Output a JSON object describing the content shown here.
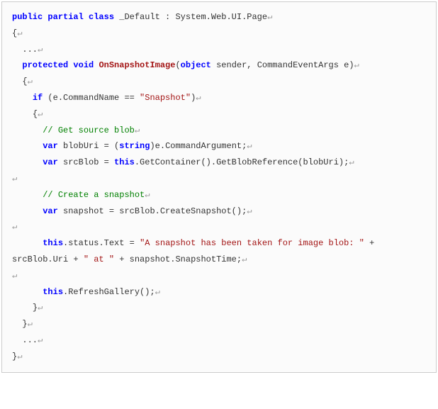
{
  "code": {
    "tokens": [
      [
        {
          "t": "public ",
          "c": "kw"
        },
        {
          "t": "partial ",
          "c": "kw"
        },
        {
          "t": "class ",
          "c": "kw"
        },
        {
          "t": "_Default",
          "c": "cls"
        },
        {
          "t": " : System.Web.UI.Page",
          "c": "plain"
        },
        {
          "t": "↵",
          "c": "nl"
        }
      ],
      [
        {
          "t": "{",
          "c": "plain"
        },
        {
          "t": "↵",
          "c": "nl"
        }
      ],
      [
        {
          "t": "  ...",
          "c": "plain"
        },
        {
          "t": "↵",
          "c": "nl"
        }
      ],
      [
        {
          "t": "  ",
          "c": "plain"
        },
        {
          "t": "protected ",
          "c": "kw"
        },
        {
          "t": "void ",
          "c": "kw"
        },
        {
          "t": "OnSnapshotImage",
          "c": "method"
        },
        {
          "t": "(",
          "c": "plain"
        },
        {
          "t": "object",
          "c": "type"
        },
        {
          "t": " sender, CommandEventArgs e)",
          "c": "plain"
        },
        {
          "t": "↵",
          "c": "nl"
        }
      ],
      [
        {
          "t": "  {",
          "c": "plain"
        },
        {
          "t": "↵",
          "c": "nl"
        }
      ],
      [
        {
          "t": "    ",
          "c": "plain"
        },
        {
          "t": "if",
          "c": "kw"
        },
        {
          "t": " (e.CommandName == ",
          "c": "plain"
        },
        {
          "t": "\"Snapshot\"",
          "c": "str"
        },
        {
          "t": ")",
          "c": "plain"
        },
        {
          "t": "↵",
          "c": "nl"
        }
      ],
      [
        {
          "t": "    {",
          "c": "plain"
        },
        {
          "t": "↵",
          "c": "nl"
        }
      ],
      [
        {
          "t": "      ",
          "c": "plain"
        },
        {
          "t": "// Get source blob",
          "c": "comment"
        },
        {
          "t": "↵",
          "c": "nl"
        }
      ],
      [
        {
          "t": "      ",
          "c": "plain"
        },
        {
          "t": "var",
          "c": "kw"
        },
        {
          "t": " blobUri = (",
          "c": "plain"
        },
        {
          "t": "string",
          "c": "type"
        },
        {
          "t": ")e.CommandArgument;",
          "c": "plain"
        },
        {
          "t": "↵",
          "c": "nl"
        }
      ],
      [
        {
          "t": "      ",
          "c": "plain"
        },
        {
          "t": "var",
          "c": "kw"
        },
        {
          "t": " srcBlob = ",
          "c": "plain"
        },
        {
          "t": "this",
          "c": "kw"
        },
        {
          "t": ".GetContainer().GetBlobReference(blobUri);",
          "c": "plain"
        },
        {
          "t": "↵",
          "c": "nl"
        }
      ],
      [
        {
          "t": "↵",
          "c": "nl"
        }
      ],
      [
        {
          "t": "      ",
          "c": "plain"
        },
        {
          "t": "// Create a snapshot",
          "c": "comment"
        },
        {
          "t": "↵",
          "c": "nl"
        }
      ],
      [
        {
          "t": "      ",
          "c": "plain"
        },
        {
          "t": "var",
          "c": "kw"
        },
        {
          "t": " snapshot = srcBlob.CreateSnapshot();",
          "c": "plain"
        },
        {
          "t": "↵",
          "c": "nl"
        }
      ],
      [
        {
          "t": "↵",
          "c": "nl"
        }
      ],
      [
        {
          "t": "      ",
          "c": "plain"
        },
        {
          "t": "this",
          "c": "kw"
        },
        {
          "t": ".status.Text = ",
          "c": "plain"
        },
        {
          "t": "\"A snapshot has been taken for image blob: \"",
          "c": "str"
        },
        {
          "t": " + srcBlob.Uri + ",
          "c": "plain"
        },
        {
          "t": "\" at \"",
          "c": "str"
        },
        {
          "t": " + snapshot.SnapshotTime;",
          "c": "plain"
        },
        {
          "t": "↵",
          "c": "nl"
        }
      ],
      [
        {
          "t": "↵",
          "c": "nl"
        }
      ],
      [
        {
          "t": "      ",
          "c": "plain"
        },
        {
          "t": "this",
          "c": "kw"
        },
        {
          "t": ".RefreshGallery();",
          "c": "plain"
        },
        {
          "t": "↵",
          "c": "nl"
        }
      ],
      [
        {
          "t": "    }",
          "c": "plain"
        },
        {
          "t": "↵",
          "c": "nl"
        }
      ],
      [
        {
          "t": "  }",
          "c": "plain"
        },
        {
          "t": "↵",
          "c": "nl"
        }
      ],
      [
        {
          "t": "  ...",
          "c": "plain"
        },
        {
          "t": "↵",
          "c": "nl"
        }
      ],
      [
        {
          "t": "}",
          "c": "plain"
        },
        {
          "t": "↵",
          "c": "nl"
        }
      ]
    ]
  }
}
